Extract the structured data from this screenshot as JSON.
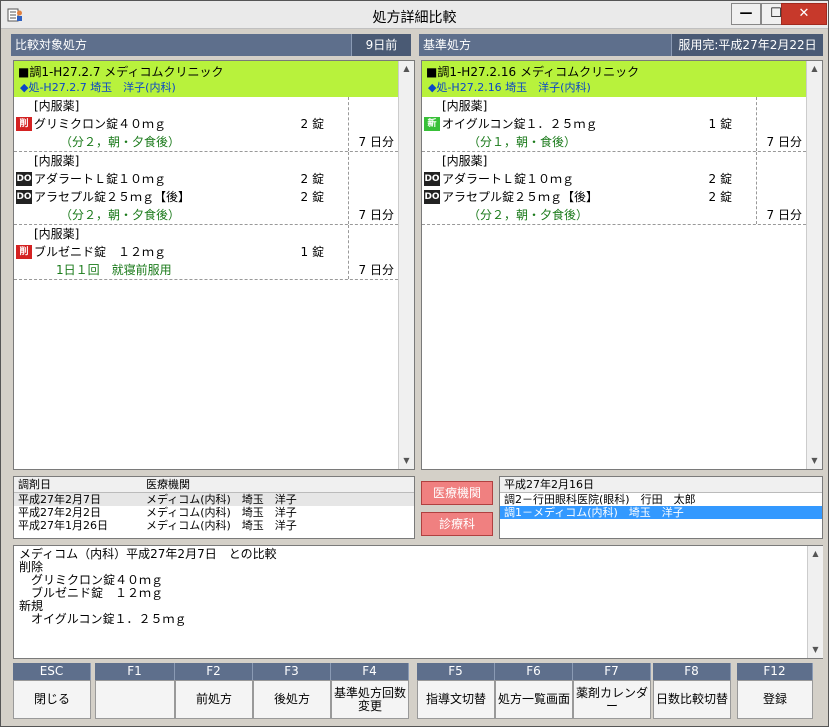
{
  "window": {
    "title": "処方詳細比較",
    "min": "—",
    "max": "☐",
    "close": "✕"
  },
  "left": {
    "header": "比較対象処方",
    "days_ago": "9日前",
    "clinic_line1": "■調1-H27.2.7 メディコムクリニック",
    "clinic_line2": "◆処-H27.2.7 埼玉　洋子(内科)",
    "groups": [
      {
        "section": "[内服薬]",
        "drugs": [
          {
            "badge": "削",
            "badge_type": "del",
            "name": "グリミクロン錠４０ｍｇ",
            "qty": "2 錠"
          }
        ],
        "usage": "（分２，朝・夕食後）",
        "days": "7 日分"
      },
      {
        "section": "[内服薬]",
        "drugs": [
          {
            "badge": "DO",
            "badge_type": "do",
            "name": "アダラートＬ錠１０ｍｇ",
            "qty": "2 錠"
          },
          {
            "badge": "DO",
            "badge_type": "do",
            "name": "アラセプル錠２５ｍｇ【後】",
            "qty": "2 錠"
          }
        ],
        "usage": "（分２，朝・夕食後）",
        "days": "7 日分"
      },
      {
        "section": "[内服薬]",
        "drugs": [
          {
            "badge": "削",
            "badge_type": "del",
            "name": "ブルゼニド錠　１２ｍｇ",
            "qty": "1 錠"
          }
        ],
        "usage": "1日１回　就寝前服用",
        "days": "7 日分"
      }
    ]
  },
  "right": {
    "header": "基準処方",
    "done": "服用完:平成27年2月22日",
    "clinic_line1": "■調1-H27.2.16 メディコムクリニック",
    "clinic_line2": "◆処-H27.2.16 埼玉　洋子(内科)",
    "groups": [
      {
        "section": "[内服薬]",
        "drugs": [
          {
            "badge": "新",
            "badge_type": "new",
            "name": "オイグルコン錠１．２５ｍｇ",
            "qty": "1 錠"
          }
        ],
        "usage": "（分１，朝・食後）",
        "days": "7 日分"
      },
      {
        "section": "[内服薬]",
        "drugs": [
          {
            "badge": "DO",
            "badge_type": "do",
            "name": "アダラートＬ錠１０ｍｇ",
            "qty": "2 錠"
          },
          {
            "badge": "DO",
            "badge_type": "do",
            "name": "アラセプル錠２５ｍｇ【後】",
            "qty": "2 錠"
          }
        ],
        "usage": "（分２，朝・夕食後）",
        "days": "7 日分"
      }
    ]
  },
  "history": {
    "col1": "調剤日",
    "col2": "医療機関",
    "rows": [
      {
        "date": "平成27年2月7日",
        "inst": "メディコム(内科)　埼玉　洋子"
      },
      {
        "date": "平成27年2月2日",
        "inst": "メディコム(内科)　埼玉　洋子"
      },
      {
        "date": "平成27年1月26日",
        "inst": "メディコム(内科)　埼玉　洋子"
      }
    ]
  },
  "buttons": {
    "institution": "医療機関",
    "department": "診療科"
  },
  "basis_list": {
    "header": "平成27年2月16日",
    "rows": [
      "調2－行田眼科医院(眼科)　行田　太郎",
      "調1－メディコム(内科)　埼玉　洋子"
    ]
  },
  "summary": "メディコム（内科）平成27年2月7日　との比較\n削除\n　グリミクロン錠４０ｍｇ\n　ブルゼニド錠　１２ｍｇ\n新規\n　オイグルコン錠１．２５ｍｇ",
  "fkeys": [
    {
      "key": "ESC",
      "label": "閉じる"
    },
    {
      "key": "F1",
      "label": ""
    },
    {
      "key": "F2",
      "label": "前処方"
    },
    {
      "key": "F3",
      "label": "後処方"
    },
    {
      "key": "F4",
      "label": "基準処方回数変更"
    },
    {
      "key": "F5",
      "label": "指導文切替"
    },
    {
      "key": "F6",
      "label": "処方一覧画面"
    },
    {
      "key": "F7",
      "label": "薬剤カレンダー"
    },
    {
      "key": "F8",
      "label": "日数比較切替"
    },
    {
      "key": "F12",
      "label": "登録"
    }
  ]
}
